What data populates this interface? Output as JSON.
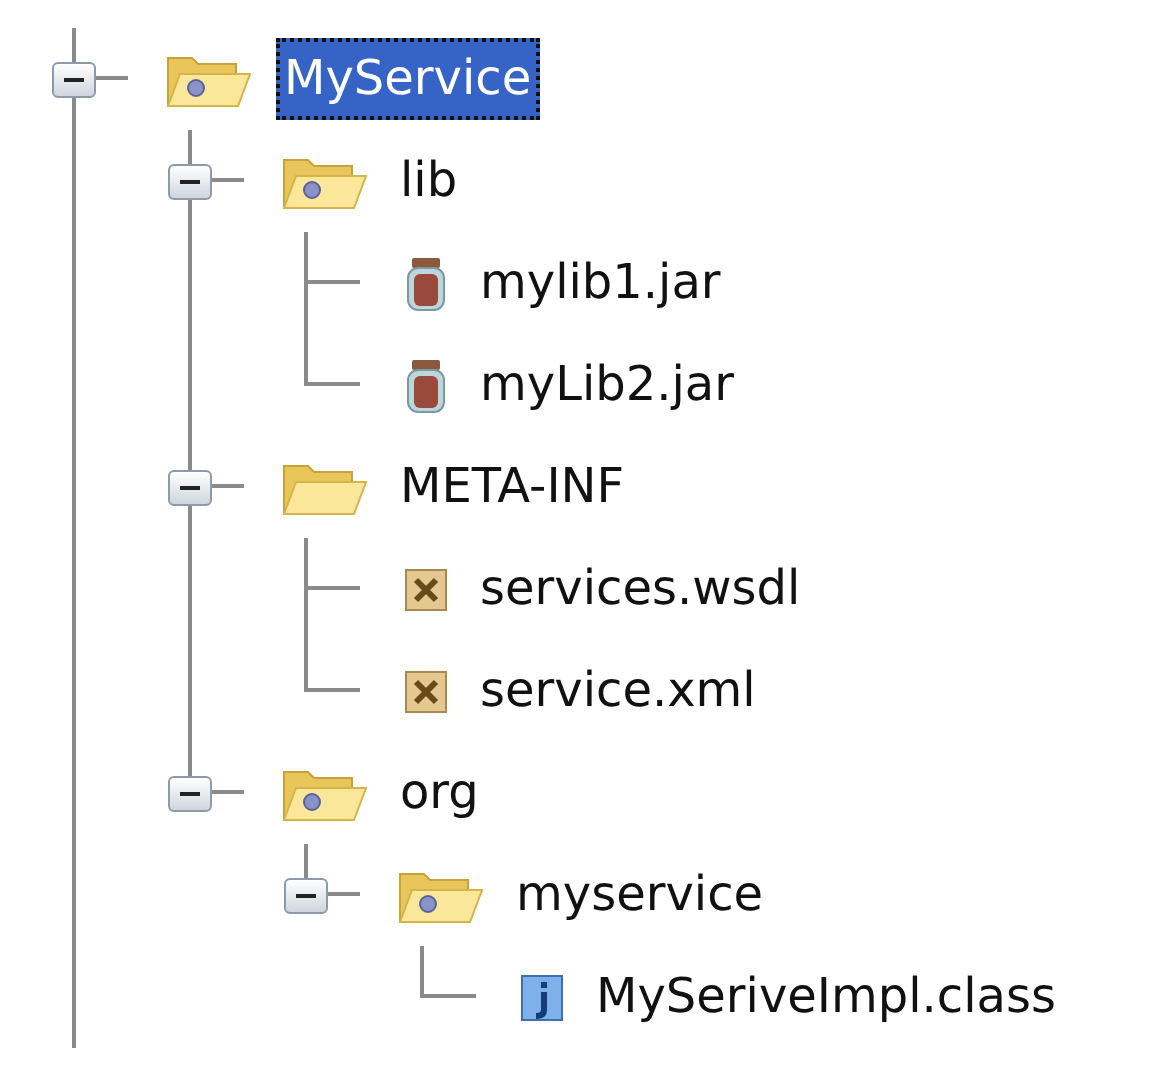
{
  "tree": [
    {
      "label": "MyService",
      "kind": "package",
      "expanded": true,
      "selected": true,
      "children": [
        {
          "label": "lib",
          "kind": "package",
          "expanded": true,
          "selected": false,
          "children": [
            {
              "label": "mylib1.jar",
              "kind": "jar",
              "selected": false
            },
            {
              "label": "myLib2.jar",
              "kind": "jar",
              "selected": false
            }
          ]
        },
        {
          "label": "META-INF",
          "kind": "folder",
          "expanded": true,
          "selected": false,
          "children": [
            {
              "label": "services.wsdl",
              "kind": "xml",
              "selected": false
            },
            {
              "label": "service.xml",
              "kind": "xml",
              "selected": false
            }
          ]
        },
        {
          "label": "org",
          "kind": "package",
          "expanded": true,
          "selected": false,
          "children": [
            {
              "label": "myservice",
              "kind": "package",
              "expanded": true,
              "selected": false,
              "children": [
                {
                  "label": "MySeriveImpl.class",
                  "kind": "class",
                  "selected": false
                }
              ]
            }
          ]
        }
      ]
    }
  ]
}
